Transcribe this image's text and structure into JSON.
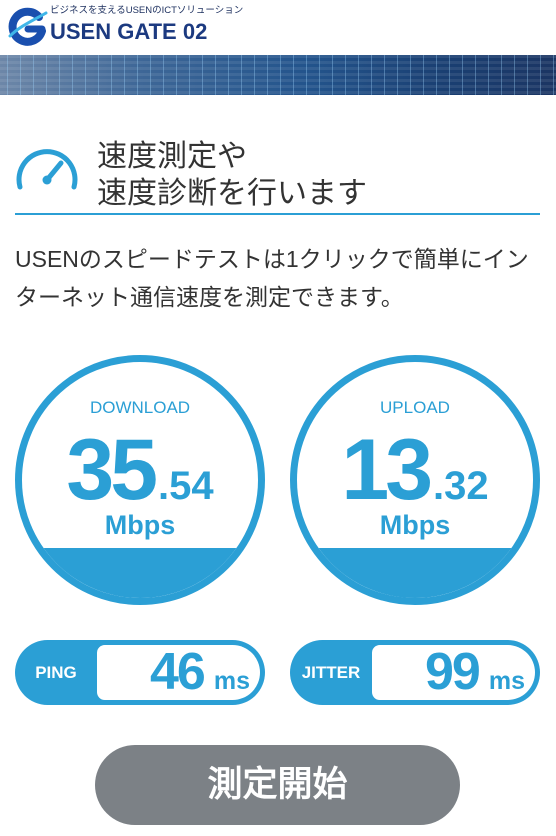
{
  "header": {
    "tagline": "ビジネスを支えるUSENのICTソリューション",
    "brand": "USEN GATE 02",
    "logo_icon": "usen-gate-logo-icon"
  },
  "banner": {
    "icon": "digital-banner-image"
  },
  "intro": {
    "icon": "speedometer-icon",
    "title_line1": "速度測定や",
    "title_line2": "速度診断を行います",
    "description_line1": "USENのスピードテストは1クリックで簡単にイン",
    "description_line2": "ターネット通信速度を測定できます。"
  },
  "results": {
    "download": {
      "label": "DOWNLOAD",
      "value_int": "35",
      "value_frac": ".54",
      "unit": "Mbps",
      "gauge_fill": 0.21
    },
    "upload": {
      "label": "UPLOAD",
      "value_int": "13",
      "value_frac": ".32",
      "unit": "Mbps",
      "gauge_fill": 0.21
    },
    "ping": {
      "label": "PING",
      "value": "46",
      "unit": "ms"
    },
    "jitter": {
      "label": "JITTER",
      "value": "99",
      "unit": "ms"
    }
  },
  "start_button": {
    "label": "測定開始"
  },
  "colors": {
    "accent": "#2b9fd5",
    "text": "#333333",
    "brand": "#1c3a80",
    "button": "#7c8186"
  }
}
